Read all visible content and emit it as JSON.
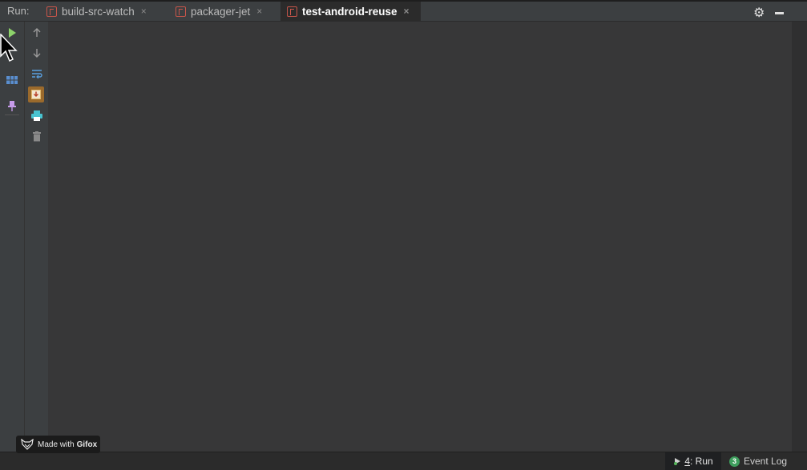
{
  "toolwindow": {
    "run_label": "Run:",
    "tabs": [
      {
        "label": "build-src-watch",
        "close": "×"
      },
      {
        "label": "packager-jet",
        "close": "×"
      },
      {
        "label": "test-android-reuse",
        "close": "×",
        "active": true
      }
    ],
    "settings_icon": "gear-icon",
    "minimize_icon": "minimize-icon"
  },
  "left_toolbar": {
    "column1": [
      "run-icon",
      "layout-icon",
      "pin-icon"
    ],
    "column2": [
      "arrow-up-icon",
      "arrow-down-icon",
      "soft-wrap-icon",
      "scroll-to-end-icon",
      "print-icon",
      "trash-icon"
    ]
  },
  "statusbar": {
    "run_number": "4",
    "run_label": ": Run",
    "event_count": "3",
    "event_label": "Event Log"
  },
  "watermark": {
    "prefix": "Made with",
    "brand": "Gifox"
  },
  "colors": {
    "accent_play": "#8dd36b",
    "tab_icon": "#c7554a",
    "badge": "#3e9e5d",
    "pin": "#c69bea",
    "print": "#48c3d0",
    "scroll_end_bg": "#9b6a2c"
  }
}
